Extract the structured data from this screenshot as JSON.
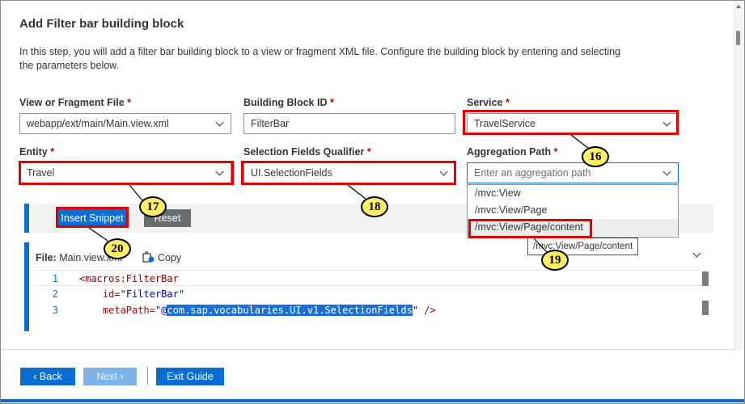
{
  "wizard": {
    "title": "Add Filter bar building block",
    "intro": "In this step, you will add a filter bar building block to a view or fragment XML file. Configure the building block by entering and selecting the parameters below."
  },
  "fields": {
    "view_file": {
      "label": "View or Fragment File",
      "required": "*",
      "value": "webapp/ext/main/Main.view.xml"
    },
    "block_id": {
      "label": "Building Block ID",
      "required": "*",
      "value": "FilterBar"
    },
    "service": {
      "label": "Service",
      "required": "*",
      "value": "TravelService"
    },
    "entity": {
      "label": "Entity",
      "required": "*",
      "value": "Travel"
    },
    "selection_qualifier": {
      "label": "Selection Fields Qualifier",
      "required": "*",
      "value": "UI.SelectionFields"
    },
    "aggregation_path": {
      "label": "Aggregation Path",
      "required": "*",
      "placeholder": "Enter an aggregation path"
    }
  },
  "aggregation_options": [
    "/mvc:View",
    "/mvc:View/Page",
    "/mvc:View/Page/content"
  ],
  "tooltip": "/mvc:View/Page/content",
  "toolbar": {
    "insert_label": "Insert Snippet",
    "reset_label": "Reset"
  },
  "file": {
    "label": "File:",
    "name": "Main.view.xml",
    "copy_label": "Copy"
  },
  "code": {
    "line_numbers": [
      "1",
      "2",
      "3"
    ],
    "line1_tag": "<macros:FilterBar",
    "line2_attr": "id=",
    "line2_val": "\"FilterBar\"",
    "line3_attr": "metaPath=",
    "line3_val_open": "\"@",
    "line3_selected": "com.sap.vocabularies.UI.v1.SelectionFields",
    "line3_val_close": "\"",
    "line3_end": " />"
  },
  "footer": {
    "back_label": "Back",
    "next_label": "Next",
    "exit_label": "Exit Guide"
  },
  "callouts": [
    "16",
    "17",
    "18",
    "19",
    "20"
  ],
  "colors": {
    "accent": "#0a6ed1",
    "callout_border": "#e00000",
    "badge_fill": "#ffee66",
    "required": "#bb0000"
  }
}
